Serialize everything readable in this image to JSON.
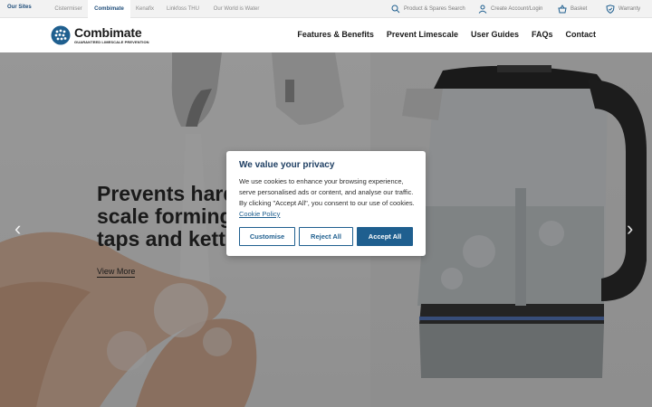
{
  "topbar": {
    "sites_label": "Our Sites",
    "tabs": [
      "Cistermiser",
      "Combimate",
      "Kenafix",
      "Linkfoss THU",
      "Our World is Water"
    ],
    "active_tab": "Combimate",
    "search_label": "Product & Spares Search",
    "account_label": "Create Account/Login",
    "basket_label": "Basket",
    "warranty_label": "Warranty"
  },
  "header": {
    "logo_name": "Combimate",
    "logo_tagline": "GUARANTEED LIMESCALE PREVENTION",
    "nav": [
      "Features & Benefits",
      "Prevent Limescale",
      "User Guides",
      "FAQs",
      "Contact"
    ]
  },
  "hero": {
    "headline_line1": "Prevents hard",
    "headline_line2": "scale forming",
    "headline_line3": "taps and kettles",
    "cta": "View More"
  },
  "cookie": {
    "title": "We value your privacy",
    "body": "We use cookies to enhance your browsing experience, serve personalised ads or content, and analyse our traffic. By clicking \"Accept All\", you consent to our use of cookies.",
    "link": "Cookie Policy",
    "customise": "Customise",
    "reject": "Reject All",
    "accept": "Accept All"
  },
  "colors": {
    "brand": "#1f5f8f",
    "title": "#1f3f63"
  }
}
